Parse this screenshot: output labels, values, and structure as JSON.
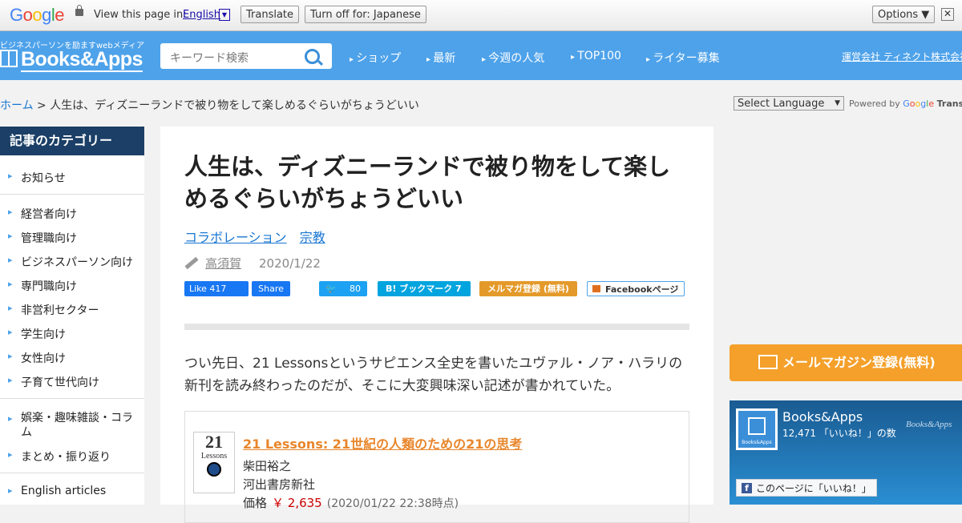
{
  "google_bar": {
    "logo": "Google",
    "view_text": "View this page in:",
    "language": "English",
    "dropdown_glyph": "▼",
    "translate_label": "Translate",
    "turnoff_label": "Turn off for: Japanese",
    "options_label": "Options ▼",
    "close_glyph": "✕"
  },
  "header": {
    "tagline": "ビジネスパーソンを励ますwebメディア",
    "logo": "Books&Apps",
    "search_placeholder": "キーワード検索",
    "nav": [
      "ショップ",
      "最新",
      "今週の人気",
      "TOP100",
      "ライター募集"
    ],
    "company": "運営会社 ティネクト株式会社"
  },
  "breadcrumb": {
    "home": "ホーム",
    "separator": " > ",
    "current": "人生は、ディズニーランドで被り物をして楽しめるぐらいがちょうどいい"
  },
  "translate_widget": {
    "select_label": "Select Language",
    "powered_by": "Powered by",
    "google": "Google",
    "translate": "Translate"
  },
  "sidebar": {
    "heading": "記事のカテゴリー",
    "items": [
      "お知らせ",
      "経営者向け",
      "管理職向け",
      "ビジネスパーソン向け",
      "専門職向け",
      "非営利セクター",
      "学生向け",
      "女性向け",
      "子育て世代向け",
      "娯楽・趣味雑談・コラム",
      "まとめ・振り返り",
      "English articles"
    ]
  },
  "article": {
    "title": "人生は、ディズニーランドで被り物をして楽しめるぐらいがちょうどいい",
    "categories": [
      "コラボレーション",
      "宗教"
    ],
    "author": "高須賀",
    "date": "2020/1/22",
    "share": {
      "fb_like": "Like 417",
      "fb_share": "Share",
      "tw_count": "80",
      "hatena": "B! ブックマーク  7",
      "mailmag": "メルマガ登録 (無料)",
      "fb_page": "Facebookページ"
    },
    "body": "つい先日、21 Lessonsというサピエンス全史を書いたユヴァル・ノア・ハラリの新刊を読み終わったのだが、そこに大変興味深い記述が書かれていた。",
    "book": {
      "cover_number": "21",
      "cover_word": "Lessons",
      "title": "21 Lessons: 21世紀の人類のための21の思考",
      "author": "柴田裕之",
      "publisher": "河出書房新社",
      "price_label": "価格",
      "price": "￥ 2,635",
      "price_time": "(2020/01/22 22:38時点)"
    }
  },
  "right": {
    "mail_button": "メールマガジン登録(無料)",
    "fb_name": "Books&Apps",
    "fb_count": "12,471 「いいね！」の数",
    "fb_watermark": "Books&Apps",
    "fb_avatar_text": "Books&Apps",
    "fb_like_button": "このページに「いいね！」"
  },
  "colors": {
    "header_blue": "#4ea2ea",
    "sidebar_head": "#1b3f66",
    "accent_orange": "#f4a02a"
  }
}
